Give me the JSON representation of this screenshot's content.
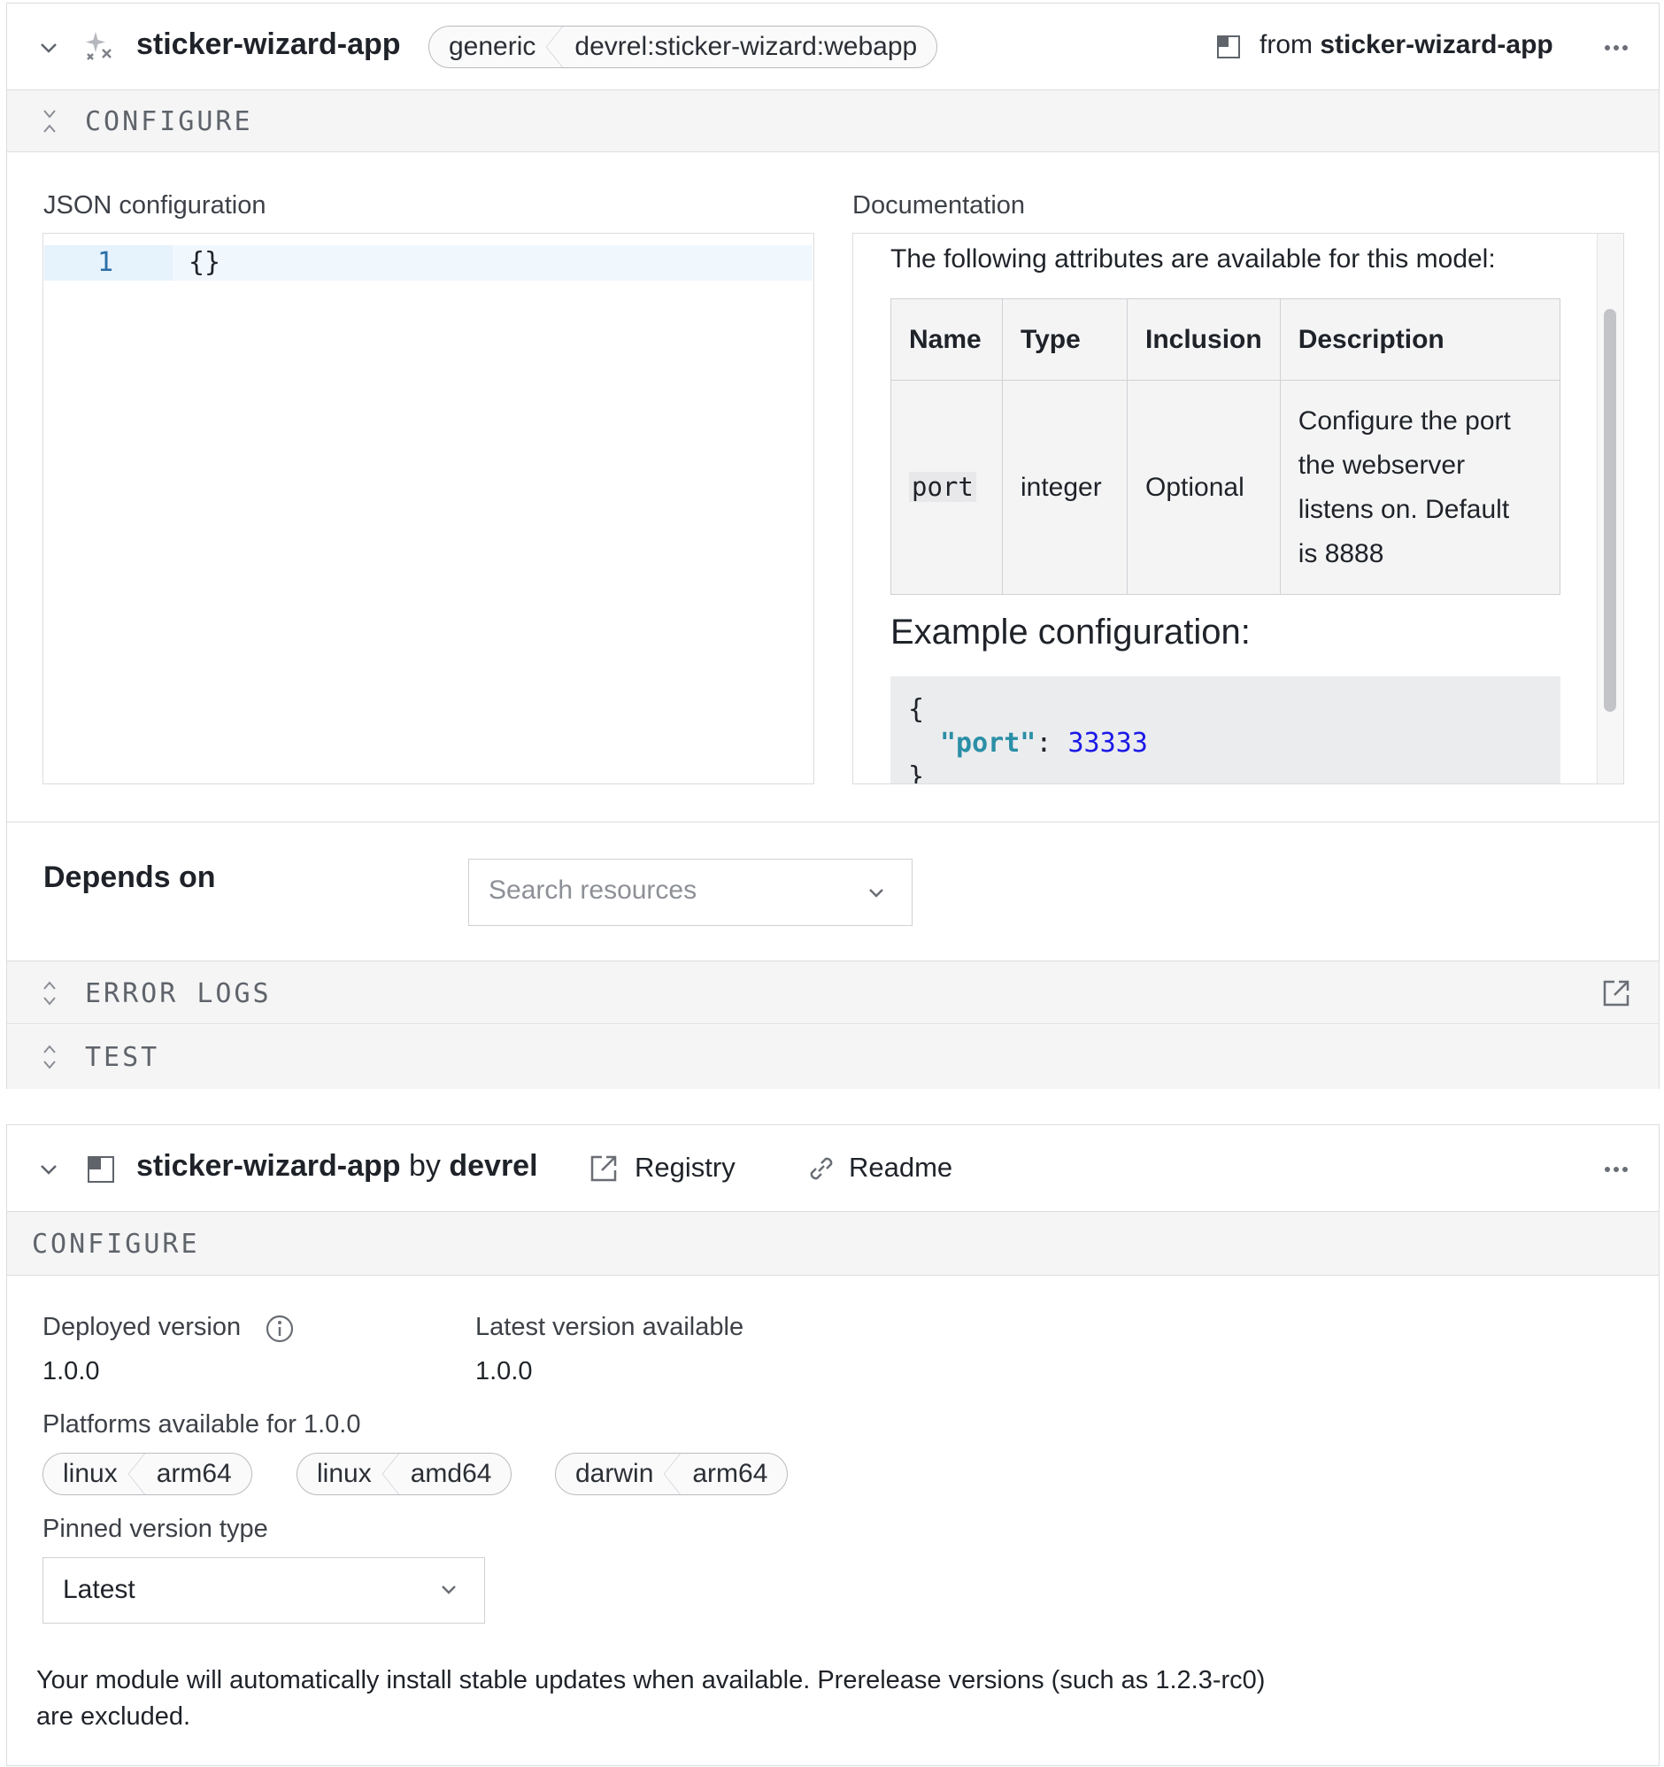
{
  "card1": {
    "title": "sticker-wizard-app",
    "tags": [
      "generic",
      "devrel:sticker-wizard:webapp"
    ],
    "from_prefix": "from",
    "from_name": "sticker-wizard-app",
    "configure_label": "CONFIGURE",
    "json_label": "JSON configuration",
    "editor": {
      "line_number": "1",
      "code": "{}"
    },
    "docs_label": "Documentation",
    "docs": {
      "intro": "The following attributes are available for this model:",
      "headers": [
        "Name",
        "Type",
        "Inclusion",
        "Description"
      ],
      "row": {
        "name": "port",
        "type": "integer",
        "inclusion": "Optional",
        "description": [
          "Configure the port",
          "the webserver",
          "listens on. Default",
          "is 8888"
        ]
      },
      "example_title": "Example configuration:",
      "example_open": "{",
      "example_key": "\"port\"",
      "example_colon": ":",
      "example_value": "33333",
      "example_close": "}"
    },
    "depends_label": "Depends on",
    "search_placeholder": "Search resources",
    "error_logs_label": "ERROR LOGS",
    "test_label": "TEST"
  },
  "card2": {
    "title": "sticker-wizard-app",
    "by": "by",
    "author": "devrel",
    "registry_label": "Registry",
    "readme_label": "Readme",
    "configure_label": "CONFIGURE",
    "deployed_label": "Deployed version",
    "deployed_value": "1.0.0",
    "latest_label": "Latest version available",
    "latest_value": "1.0.0",
    "platforms_label": "Platforms available for 1.0.0",
    "platforms": [
      {
        "os": "linux",
        "arch": "arm64"
      },
      {
        "os": "linux",
        "arch": "amd64"
      },
      {
        "os": "darwin",
        "arch": "arm64"
      }
    ],
    "pinned_label": "Pinned version type",
    "pinned_value": "Latest",
    "note_line1": "Your module will automatically install stable updates when available. Prerelease versions (such as 1.2.3-rc0)",
    "note_line2": "are excluded."
  },
  "colors": {
    "border": "#dcdde0",
    "section_bg": "#f5f5f6",
    "json_key": "#2a8fa6",
    "json_number": "#1a1ae6",
    "line_number": "#2b6fa8"
  },
  "icons": [
    "chevron-down-icon",
    "sparkle-icon",
    "module-icon",
    "more-icon",
    "collapse-icon",
    "expand-icon",
    "external-link-icon",
    "link-icon",
    "info-icon"
  ]
}
